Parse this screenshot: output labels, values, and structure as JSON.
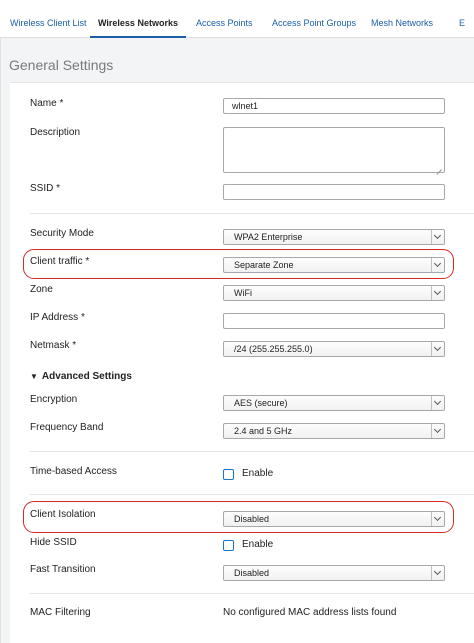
{
  "tabs": [
    {
      "label": "Wireless Client List"
    },
    {
      "label": "Wireless Networks",
      "active": true
    },
    {
      "label": "Access Points"
    },
    {
      "label": "Access Point Groups"
    },
    {
      "label": "Mesh Networks"
    },
    {
      "label": "E"
    }
  ],
  "section_title": "General Settings",
  "form": {
    "name": {
      "label": "Name *",
      "value": "wlnet1"
    },
    "description": {
      "label": "Description",
      "value": ""
    },
    "ssid": {
      "label": "SSID *",
      "value": ""
    },
    "security_mode": {
      "label": "Security Mode",
      "value": "WPA2 Enterprise"
    },
    "client_traffic": {
      "label": "Client traffic *",
      "value": "Separate Zone"
    },
    "zone": {
      "label": "Zone",
      "value": "WiFi"
    },
    "ip_address": {
      "label": "IP Address *",
      "value": ""
    },
    "netmask": {
      "label": "Netmask *",
      "value": "/24 (255.255.255.0)"
    }
  },
  "advanced": {
    "toggle_label": "Advanced Settings",
    "caret": "▼",
    "encryption": {
      "label": "Encryption",
      "value": "AES (secure)"
    },
    "frequency_band": {
      "label": "Frequency Band",
      "value": "2.4 and 5 GHz"
    },
    "time_based_access": {
      "label": "Time-based Access",
      "checkbox_label": "Enable",
      "checked": false
    },
    "client_isolation": {
      "label": "Client Isolation",
      "value": "Disabled"
    },
    "hide_ssid": {
      "label": "Hide SSID",
      "checkbox_label": "Enable",
      "checked": false
    },
    "fast_transition": {
      "label": "Fast Transition",
      "value": "Disabled"
    },
    "mac_filtering": {
      "label": "MAC Filtering",
      "value": "No configured MAC address lists found"
    }
  },
  "colors": {
    "link": "#1a5fa8",
    "highlight": "#d72828",
    "checkbox": "#1a73c8"
  }
}
